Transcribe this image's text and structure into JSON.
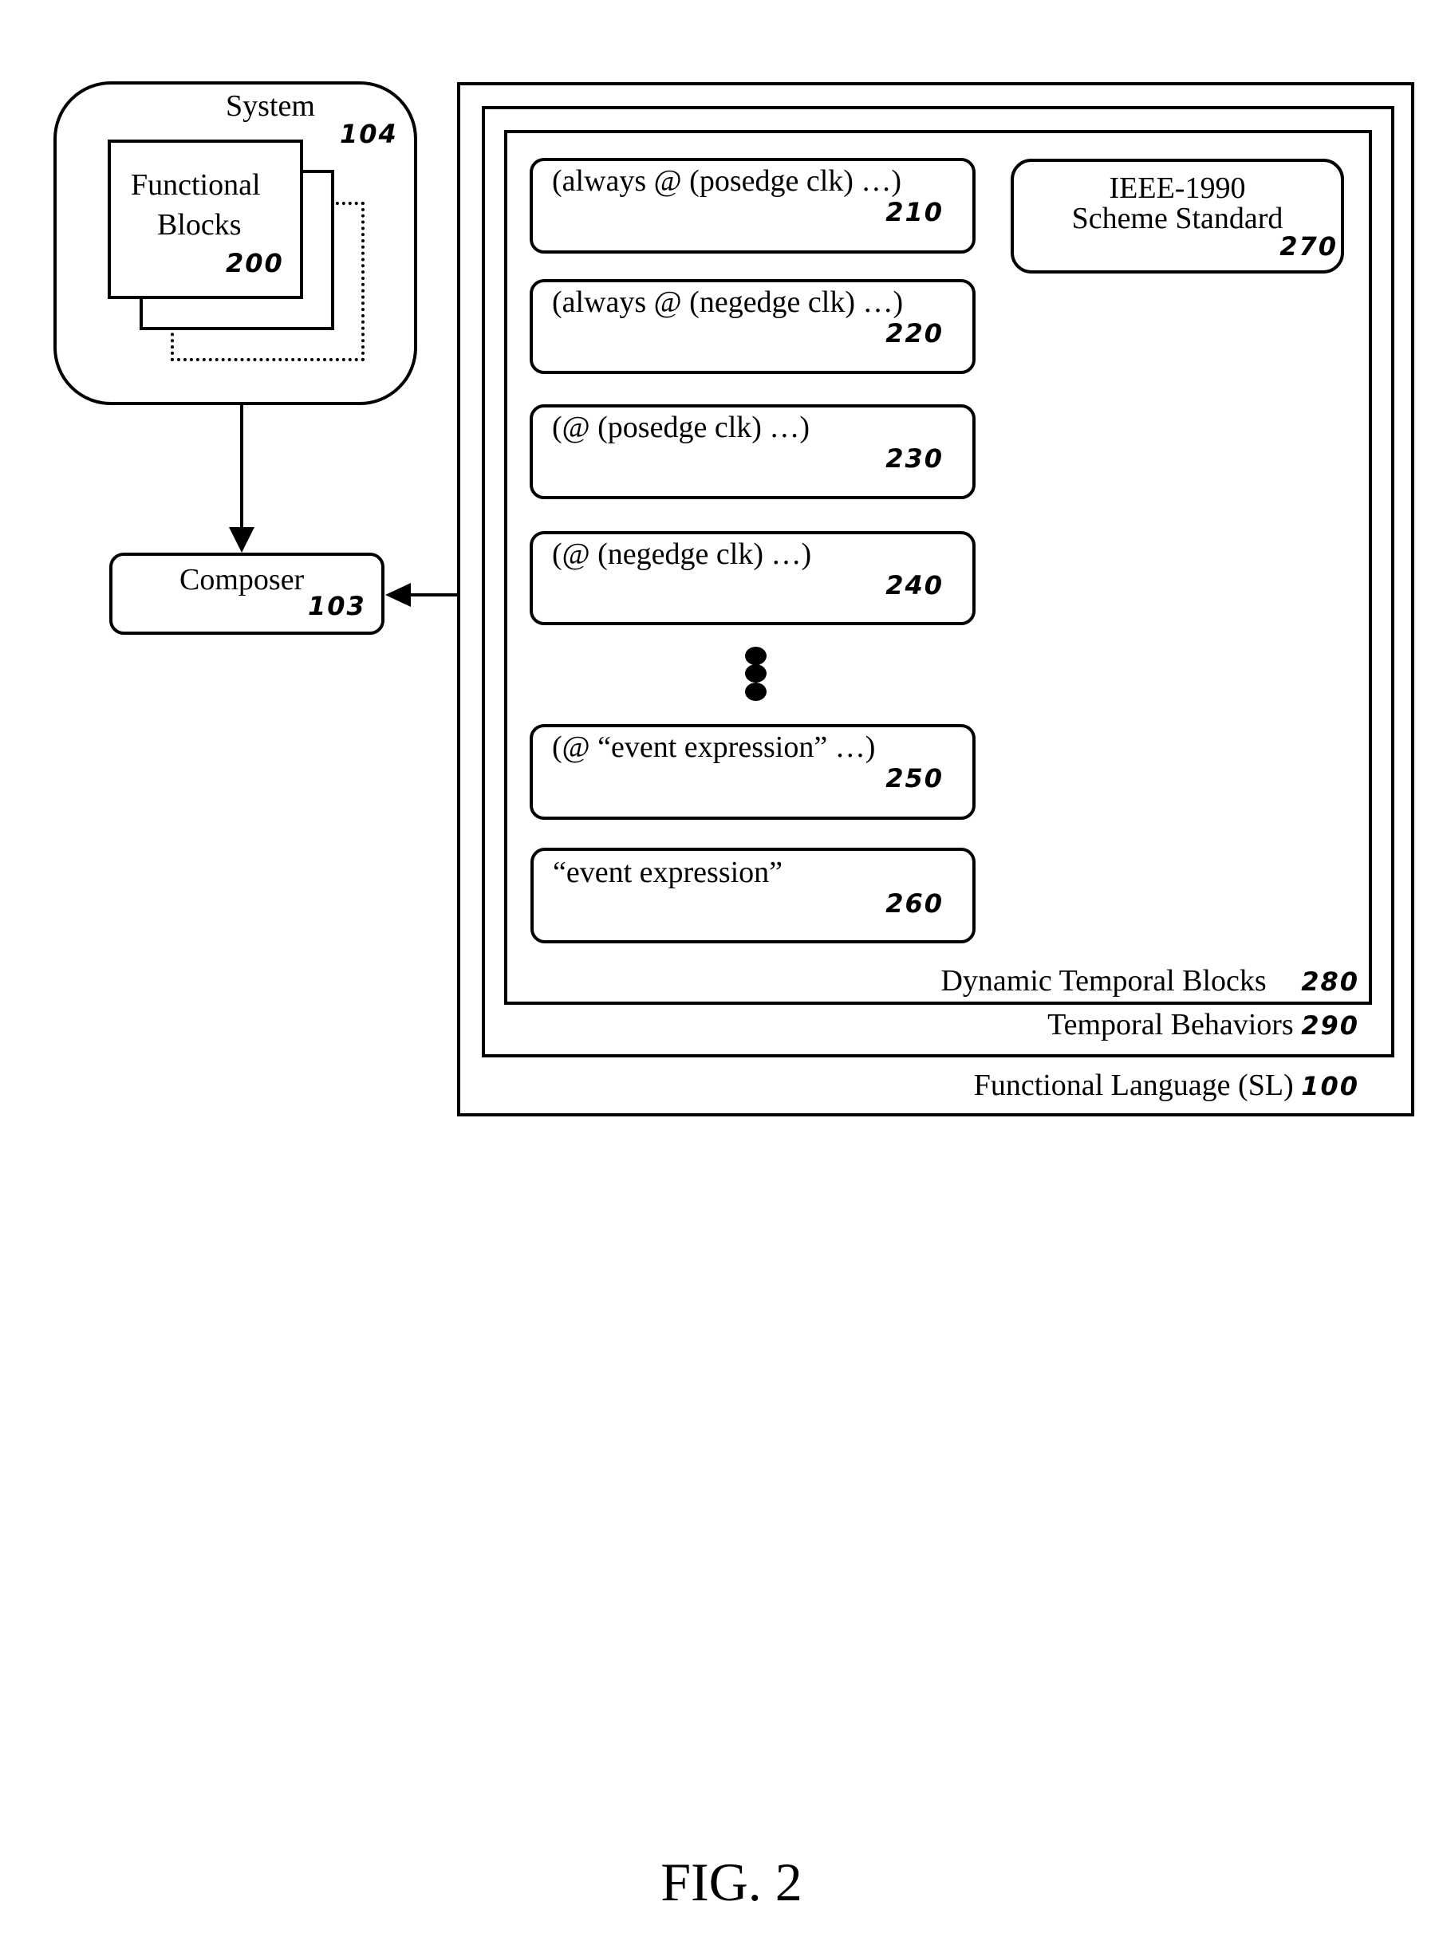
{
  "figure": {
    "caption": "FIG. 2"
  },
  "system": {
    "title": "System",
    "ref": "104",
    "functional_blocks": {
      "line1": "Functional",
      "line2": "Blocks",
      "ref": "200"
    }
  },
  "composer": {
    "title": "Composer",
    "ref": "103"
  },
  "functional_language": {
    "label": "Functional Language (SL)",
    "ref": "100"
  },
  "temporal_behaviors": {
    "label": "Temporal Behaviors",
    "ref": "290"
  },
  "dynamic_temporal_blocks": {
    "label": "Dynamic Temporal Blocks",
    "ref": "280",
    "blocks": [
      {
        "text": "(always @ (posedge clk) …)",
        "ref": "210"
      },
      {
        "text": "(always @ (negedge clk) …)",
        "ref": "220"
      },
      {
        "text": "(@ (posedge clk) …)",
        "ref": "230"
      },
      {
        "text": "(@ (negedge clk) …)",
        "ref": "240"
      },
      {
        "text": "(@ “event expression” …)",
        "ref": "250"
      },
      {
        "text": "“event expression”",
        "ref": "260"
      }
    ]
  },
  "scheme_standard": {
    "line1": "IEEE-1990",
    "line2": "Scheme Standard",
    "ref": "270"
  }
}
